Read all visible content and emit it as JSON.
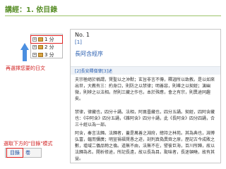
{
  "slide": {
    "title": "講經：1. 依目錄"
  },
  "tree": {
    "items": [
      {
        "label": "1 分",
        "selected": true
      },
      {
        "label": "2 分",
        "selected": false
      },
      {
        "label": "3 分",
        "selected": false
      }
    ]
  },
  "hints": {
    "select_item": "再選擇您要的日文",
    "select_tab": "選取下方的\"目錄\"模式"
  },
  "tabs": [
    {
      "label": "目錄",
      "active": true
    },
    {
      "label": "卷",
      "active": false
    }
  ],
  "document": {
    "number": "No. 1",
    "ref": "[1]",
    "title": "長阿含經序",
    "section": "[2]長安釋僧肇[3]述",
    "para1": "夫宗極絕於稱謂，賢聖以之沖默；玄旨非言不傳，釋迦所以致教。是以如來出世，大教有三：約身口，則防之以禁律；明善惡，則導之以契經；演幽微，則辨之以法相。然則三藏之作也，本於殊應，會之有宗，則異途同趣矣。",
    "para2": "禁律，律藏也，四分十誦。法相，阿毘曇藏也，四分五誦。契經，四阿含藏也：《中阿含》四分五誦，《雜阿含》四分十誦，此《長阿含》四分四誦，合三十經以為一部。",
    "para3": "阿含，秦言法歸。法歸者，蓋是萬善之淵府，總持之林苑。其為典也，淵博弘富，韞而彌廣；明宣禍福賢愚之迹，剖判真偽異齊之原，歷記古今成敗之數，墟域二儀品物之倫。道無不由，法無不在，譬彼巨海，百川所歸，故以法歸為名。開析修途，所記長遠，故以長為目。翫味者，長迷頓曉，故有其益。"
  }
}
